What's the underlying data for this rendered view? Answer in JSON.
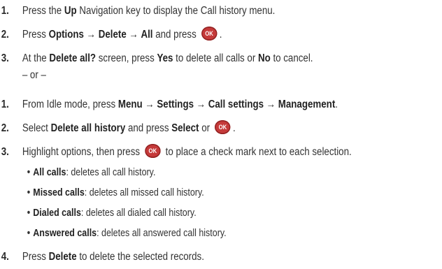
{
  "section_a": {
    "step1": {
      "num": "1.",
      "pre": "Press the ",
      "b1": "Up",
      "post": " Navigation key to display the Call history menu."
    },
    "step2": {
      "num": "2.",
      "pre": "Press ",
      "b1": "Options",
      "arrow1": " → ",
      "b2": "Delete",
      "arrow2": " → ",
      "b3": "All",
      "post": " and press ",
      "end": "."
    },
    "step3": {
      "num": "3.",
      "pre": "At the ",
      "b1": "Delete all?",
      "mid1": " screen, press ",
      "b2": "Yes",
      "mid2": " to delete all calls or ",
      "b3": "No",
      "post": " to cancel."
    }
  },
  "or_text": "– or –",
  "section_b": {
    "step1": {
      "num": "1.",
      "pre": "From Idle mode, press ",
      "b1": "Menu",
      "a1": " → ",
      "b2": "Settings",
      "a2": " → ",
      "b3": "Call settings",
      "a3": " → ",
      "b4": "Management",
      "post": "."
    },
    "step2": {
      "num": "2.",
      "pre": "Select ",
      "b1": "Delete all history",
      "mid": " and press ",
      "b2": "Select",
      "post": " or ",
      "end": "."
    },
    "step3": {
      "num": "3.",
      "pre": "Highlight options, then press ",
      "post": " to place a check mark next to each selection."
    },
    "bullets": [
      {
        "bullet": "•",
        "label": "All calls",
        "desc": ": deletes all call history."
      },
      {
        "bullet": "•",
        "label": "Missed calls",
        "desc": ": deletes all missed call history."
      },
      {
        "bullet": "•",
        "label": "Dialed calls",
        "desc": ": deletes all dialed call history."
      },
      {
        "bullet": "•",
        "label": "Answered calls",
        "desc": ": deletes all answered call history."
      }
    ],
    "step4": {
      "num": "4.",
      "pre": "Press ",
      "b1": "Delete",
      "post": " to delete the selected records."
    }
  },
  "ok_key_label": "OK",
  "colors": {
    "ok_key": "#c53a3a",
    "text": "#333333"
  }
}
